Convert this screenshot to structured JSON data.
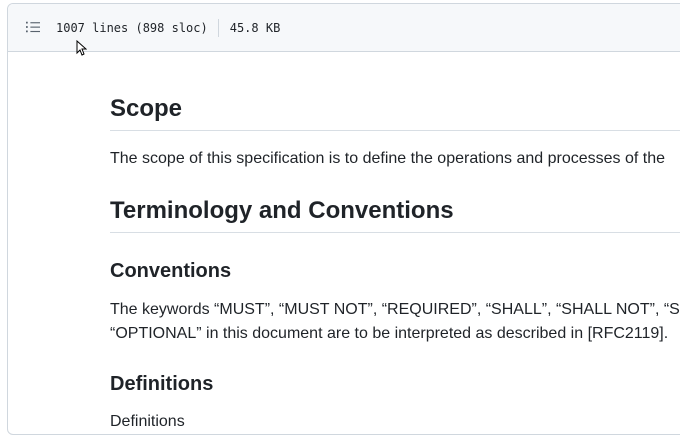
{
  "file_header": {
    "lines": "1007 lines (898 sloc)",
    "size": "45.8 KB"
  },
  "markdown": {
    "scope_heading": "Scope",
    "scope_text": "The scope of this specification is to define the operations and processes of the",
    "terminology_heading": "Terminology and Conventions",
    "conventions_heading": "Conventions",
    "conventions_line1": "The keywords “MUST”, “MUST NOT”, “REQUIRED”, “SHALL”, “SHALL NOT”, “SH",
    "conventions_line2": "“OPTIONAL” in this document are to be interpreted as described in [RFC2119].",
    "definitions_heading": "Definitions",
    "definitions_text": "Definitions"
  },
  "icons": {
    "outline": "list-unordered-icon",
    "cursor": "mouse-pointer-icon"
  },
  "colors": {
    "header_bg": "#f6f8fa",
    "border": "#d0d7de",
    "text": "#1f2328"
  }
}
